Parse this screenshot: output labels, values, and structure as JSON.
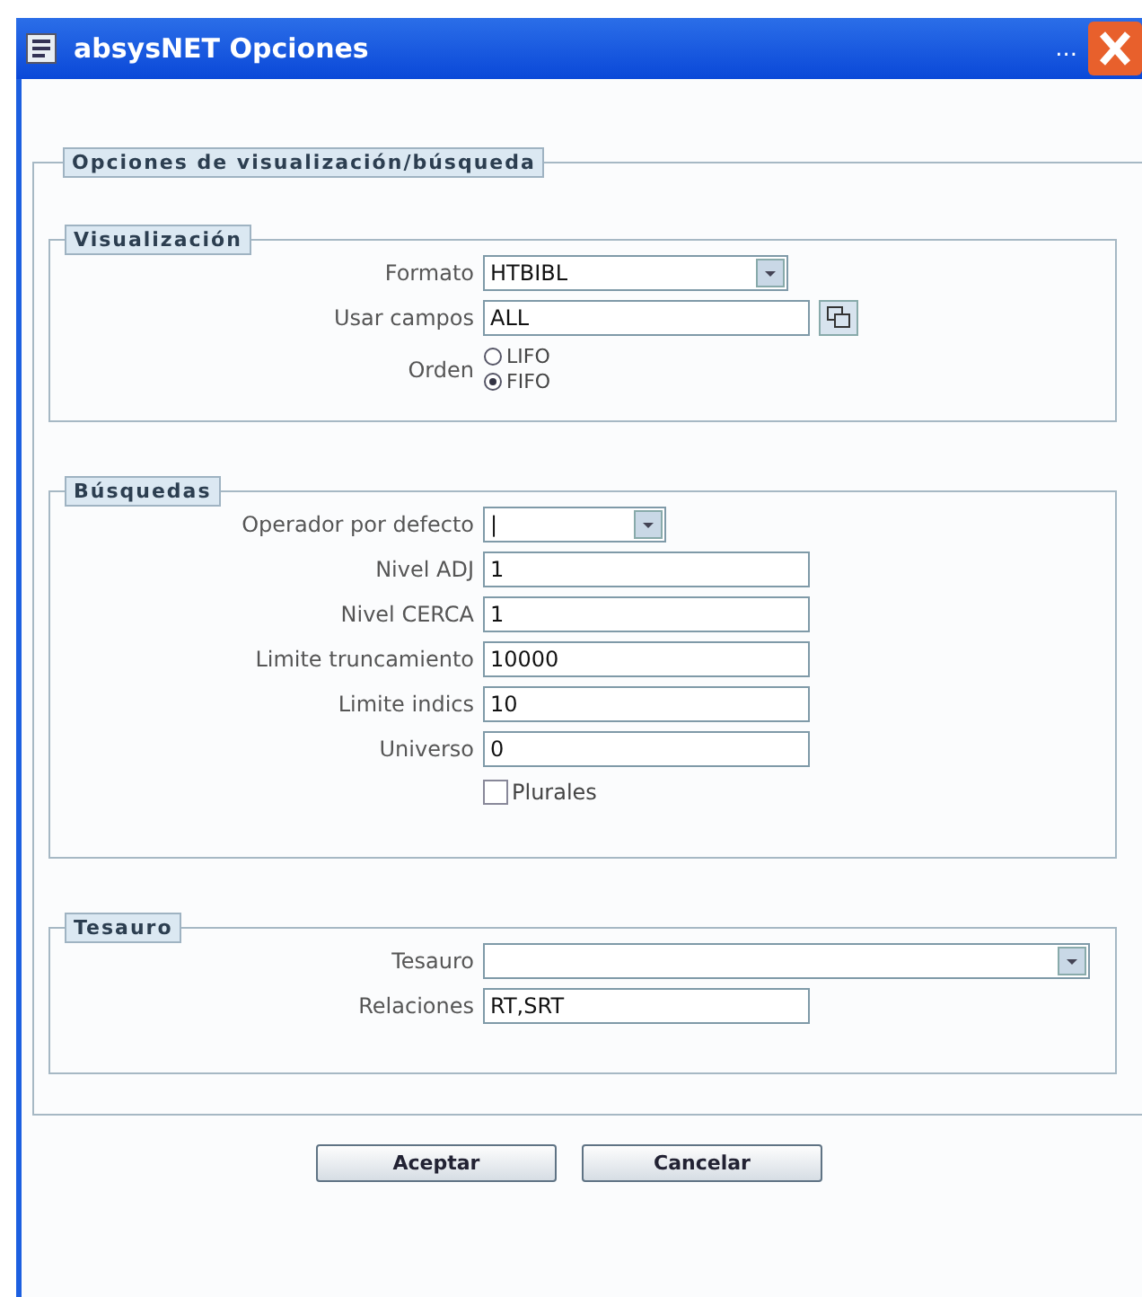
{
  "window": {
    "title": "absysNET Opciones",
    "title_overflow": "..."
  },
  "panel": {
    "legend": "Opciones de visualización/búsqueda",
    "sections": [
      {
        "legend": "Visualización",
        "fields": [
          {
            "kind": "select",
            "label": "Formato",
            "value": "HTBIBL"
          },
          {
            "kind": "picker",
            "label": "Usar campos",
            "value": "ALL"
          },
          {
            "kind": "radio",
            "label": "Orden",
            "options": [
              {
                "label": "LIFO",
                "selected": false
              },
              {
                "label": "FIFO",
                "selected": true
              }
            ]
          }
        ]
      },
      {
        "legend": "Búsquedas",
        "fields": [
          {
            "kind": "select",
            "label": "Operador por defecto",
            "value": "|"
          },
          {
            "kind": "text",
            "label": "Nivel ADJ",
            "value": "1"
          },
          {
            "kind": "text",
            "label": "Nivel CERCA",
            "value": "1"
          },
          {
            "kind": "text",
            "label": "Limite truncamiento",
            "value": "10000"
          },
          {
            "kind": "text",
            "label": "Limite indics",
            "value": "10"
          },
          {
            "kind": "text",
            "label": "Universo",
            "value": "0"
          },
          {
            "kind": "checkbox",
            "label": "Plurales",
            "checked": false
          }
        ]
      },
      {
        "legend": "Tesauro",
        "fields": [
          {
            "kind": "select",
            "label": "Tesauro"
          },
          {
            "kind": "text",
            "label": "Relaciones",
            "value": "RT,SRT"
          }
        ]
      }
    ]
  },
  "buttons": [
    "Aceptar",
    "Cancelar"
  ]
}
